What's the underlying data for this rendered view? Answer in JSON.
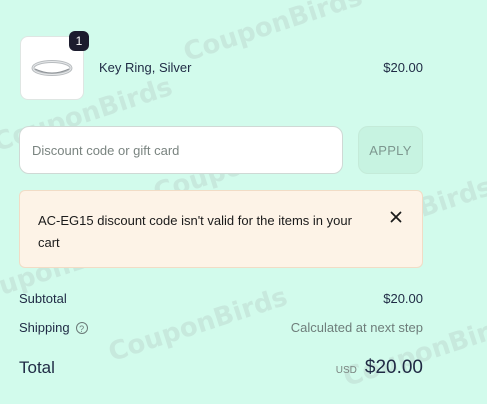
{
  "order_item": {
    "quantity": "1",
    "name": "Key Ring, Silver",
    "price": "$20.00",
    "image_icon": "ring-image"
  },
  "discount": {
    "placeholder": "Discount code or gift card",
    "apply_label": "APPLY"
  },
  "alert": {
    "message": "AC-EG15 discount code isn't valid for the items in your cart",
    "close_icon": "close-icon"
  },
  "summary": {
    "subtotal_label": "Subtotal",
    "subtotal_value": "$20.00",
    "shipping_label": "Shipping",
    "shipping_value": "Calculated at next step",
    "total_label": "Total",
    "currency": "USD",
    "total_value": "$20.00"
  },
  "watermark": "CouponBirds",
  "colors": {
    "background": "#d2fbec",
    "alert_bg": "#fdf3e7",
    "apply_bg": "#c7f3e1",
    "text": "#1f2a44"
  }
}
